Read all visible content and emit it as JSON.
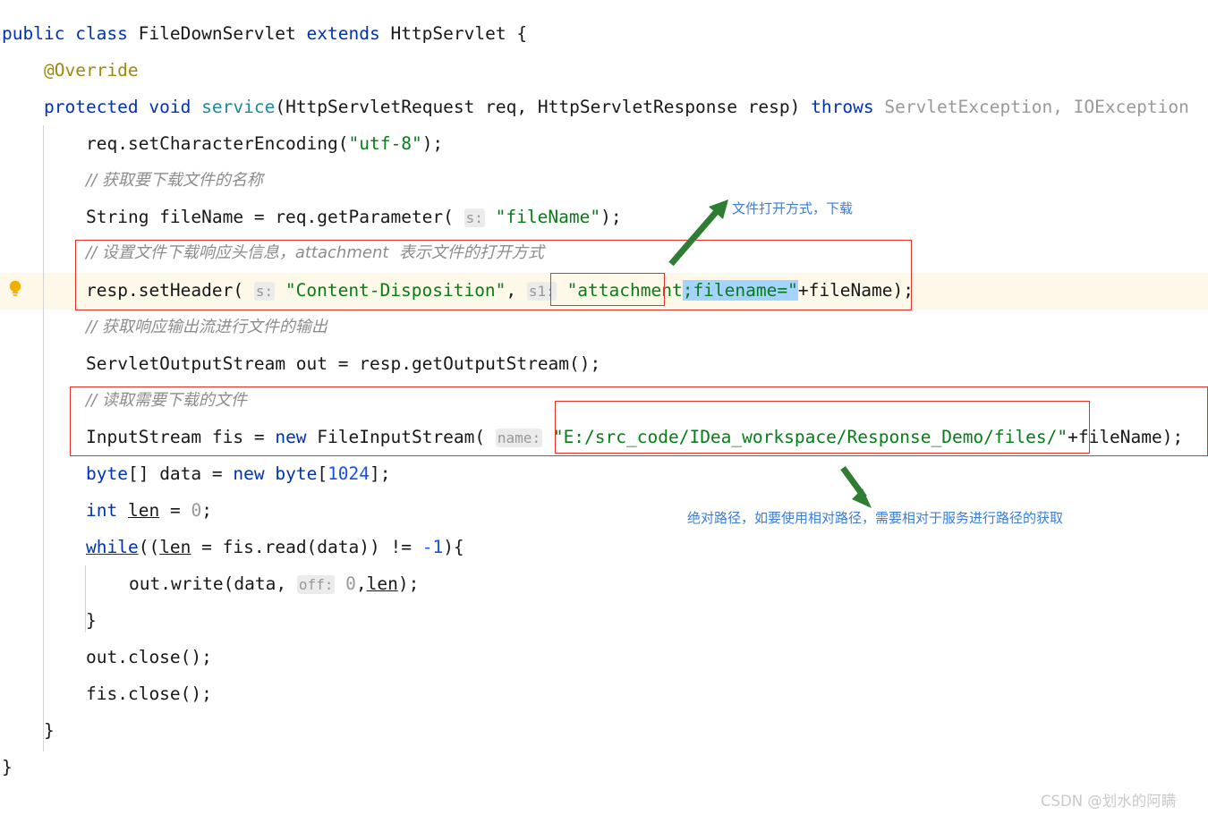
{
  "editor": {
    "language": "java",
    "class_declaration": {
      "modifier": "public",
      "keyword_class": "class",
      "class_name": "FileDownServlet",
      "extends_keyword": "extends",
      "super_class": "HttpServlet",
      "brace": "{"
    },
    "annotation": "@Override",
    "method_signature": {
      "modifier": "protected",
      "return_type": "void",
      "name": "service",
      "open_paren": "(",
      "param1_type": "HttpServletRequest",
      "param1_name": "req,",
      "param2_type": "HttpServletResponse",
      "param2_name": "resp)",
      "throws_keyword": "throws",
      "exceptions": "ServletException, IOException"
    },
    "lines": {
      "set_encoding_call": "req.setCharacterEncoding(",
      "set_encoding_arg": "\"utf-8\"",
      "set_encoding_tail": ");",
      "comment_get_filename": "// 获取要下载文件的名称",
      "filename_decl": "String fileName = req.getParameter(",
      "filename_hint": "s:",
      "filename_arg": "\"fileName\"",
      "filename_tail": ");",
      "comment_set_header": "// 设置文件下载响应头信息，attachment  表示文件的打开方式",
      "setheader_call": "resp.setHeader(",
      "setheader_hint1": "s:",
      "setheader_arg1": "\"Content-Disposition\"",
      "setheader_comma": ", ",
      "setheader_hint2": "s1:",
      "setheader_arg2_boxed": "\"attachment",
      "setheader_arg2_selected": ";filename=\"",
      "setheader_tail": "+fileName);",
      "comment_get_stream": "// 获取响应输出流进行文件的输出",
      "outstream_decl": "ServletOutputStream out = resp.getOutputStream();",
      "comment_read_file": "// 读取需要下载的文件",
      "inputstream_decl": "InputStream fis = ",
      "inputstream_new": "new",
      "inputstream_ctor": " FileInputStream(",
      "inputstream_hint": "name:",
      "inputstream_path": "\"E:/src_code/IDea_workspace/Response_Demo/files/\"",
      "inputstream_tail": "+fileName);",
      "byte_decl_pre": "byte",
      "byte_decl_mid": "[] data = ",
      "byte_decl_new": "new",
      "byte_decl_type": " byte",
      "byte_decl_size": "1024",
      "byte_decl_tail": "];",
      "int_kw": "int",
      "int_var": "len",
      "int_assign": " = ",
      "int_value": "0",
      "int_tail": ";",
      "while_kw": "while",
      "while_open": "((",
      "while_var": "len",
      "while_mid": " = fis.read(data)) != ",
      "while_num": "-1",
      "while_tail": "){",
      "write_call": "out.write(data, ",
      "write_hint": "off:",
      "write_zero": "0",
      "write_comma": ",",
      "write_len": "len",
      "write_tail": ");",
      "close_brace_inner": "}",
      "out_close": "out.close();",
      "fis_close": "fis.close();",
      "close_brace_method": "}",
      "close_brace_class": "}"
    }
  },
  "annotations": [
    {
      "id": "note-open-mode",
      "text": "文件打开方式，下载",
      "color": "#3b7dd8",
      "arrow": "green-arrow-up-left"
    },
    {
      "id": "note-absolute-path",
      "text": "绝对路径，如要使用相对路径，需要相对于服务进行路径的获取",
      "color": "#3b7dd8",
      "arrow": "green-arrow-down"
    }
  ],
  "highlight": {
    "current_line_color": "#fdf8e7",
    "selection_color": "#a6d2ff",
    "box_color": "#e8312a",
    "gutter_icon": "lightbulb-icon"
  },
  "watermark": {
    "text": "CSDN @划水的阿瞒"
  }
}
